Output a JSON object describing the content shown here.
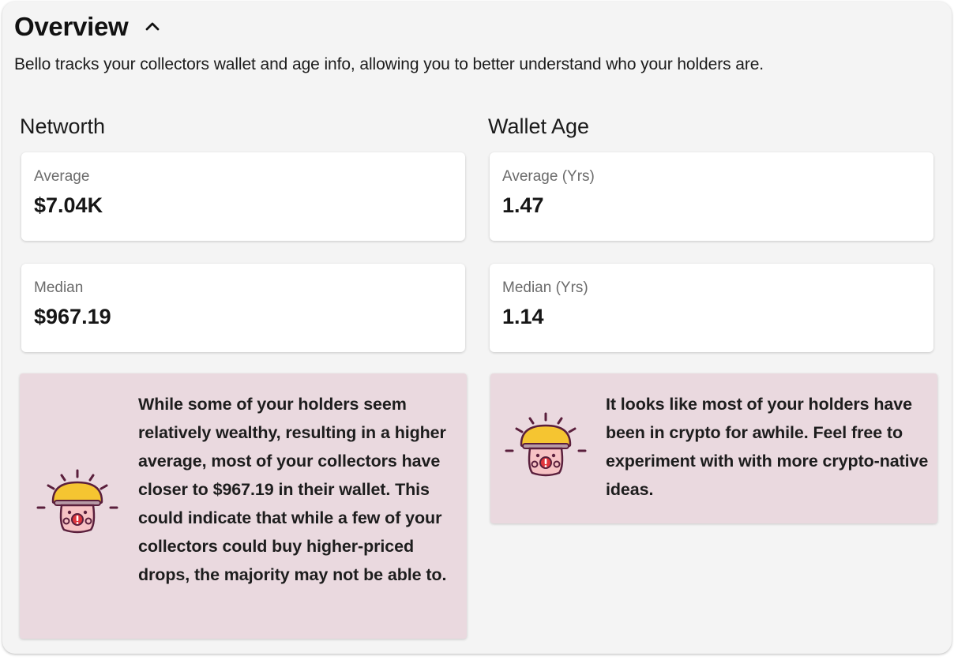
{
  "overview": {
    "title": "Overview",
    "description": "Bello tracks your collectors wallet and age info, allowing you to better understand who your holders are."
  },
  "networth": {
    "title": "Networth",
    "average_label": "Average",
    "average_value": "$7.04K",
    "median_label": "Median",
    "median_value": "$967.19",
    "insight": "While some of your holders seem relatively wealthy, resulting in a higher average, most of your collectors have closer to $967.19 in their wallet. This could indicate that while a few of your collectors could buy higher-priced drops, the majority may not be able to."
  },
  "wallet_age": {
    "title": "Wallet Age",
    "average_label": "Average (Yrs)",
    "average_value": "1.47",
    "median_label": "Median (Yrs)",
    "median_value": "1.14",
    "insight": "It looks like most of your holders have been in crypto for awhile. Feel free to experiment with with more crypto-native ideas."
  },
  "icons": {
    "collapse": "chevron-up-icon",
    "mascot": "mushroom-mascot-icon"
  },
  "colors": {
    "panel_bg": "#f4f4f4",
    "card_bg": "#ffffff",
    "insight_bg": "#ead9df",
    "mascot_cap": "#f5c531",
    "mascot_accent": "#5a1f3c",
    "mascot_mouth": "#e0363d"
  }
}
